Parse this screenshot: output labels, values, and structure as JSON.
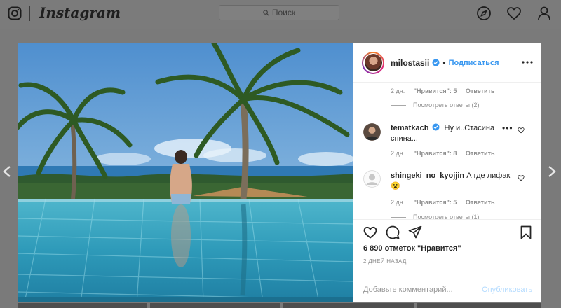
{
  "nav": {
    "brand": "Instagram",
    "search_placeholder": "Поиск",
    "icons": [
      "instagram-glyph-icon",
      "search-icon",
      "explore-compass-icon",
      "heart-icon",
      "profile-icon"
    ]
  },
  "post": {
    "author": "milostasii",
    "follow_label": "Подписаться",
    "separator": "•",
    "likes_label": "6 890 отметок \"Нравится\"",
    "posted_ago": "2 ДНЕЙ НАЗАД",
    "comment_placeholder": "Добавьте комментарий...",
    "publish_label": "Опубликовать"
  },
  "comments": [
    {
      "meta": {
        "time": "2 дн.",
        "likes": "\"Нравится\": 5",
        "reply": "Ответить"
      },
      "view_replies": "Посмотреть ответы (2)"
    },
    {
      "username": "tematkach",
      "verified": true,
      "text": "Ну и..Стасина спина...",
      "meta": {
        "time": "2 дн.",
        "likes": "\"Нравится\": 8",
        "reply": "Ответить"
      },
      "more": "•••"
    },
    {
      "username": "shingeki_no_kyojjin",
      "text": "А где лифак 😮",
      "meta": {
        "time": "2 дн.",
        "likes": "\"Нравится\": 5",
        "reply": "Ответить"
      },
      "view_replies": "Посмотреть ответы (1)"
    }
  ],
  "colors": {
    "accent": "#3897f0",
    "overlay": "#7a7a7a",
    "muted": "#8e8e8e",
    "publish_disabled": "#b3dbff"
  }
}
